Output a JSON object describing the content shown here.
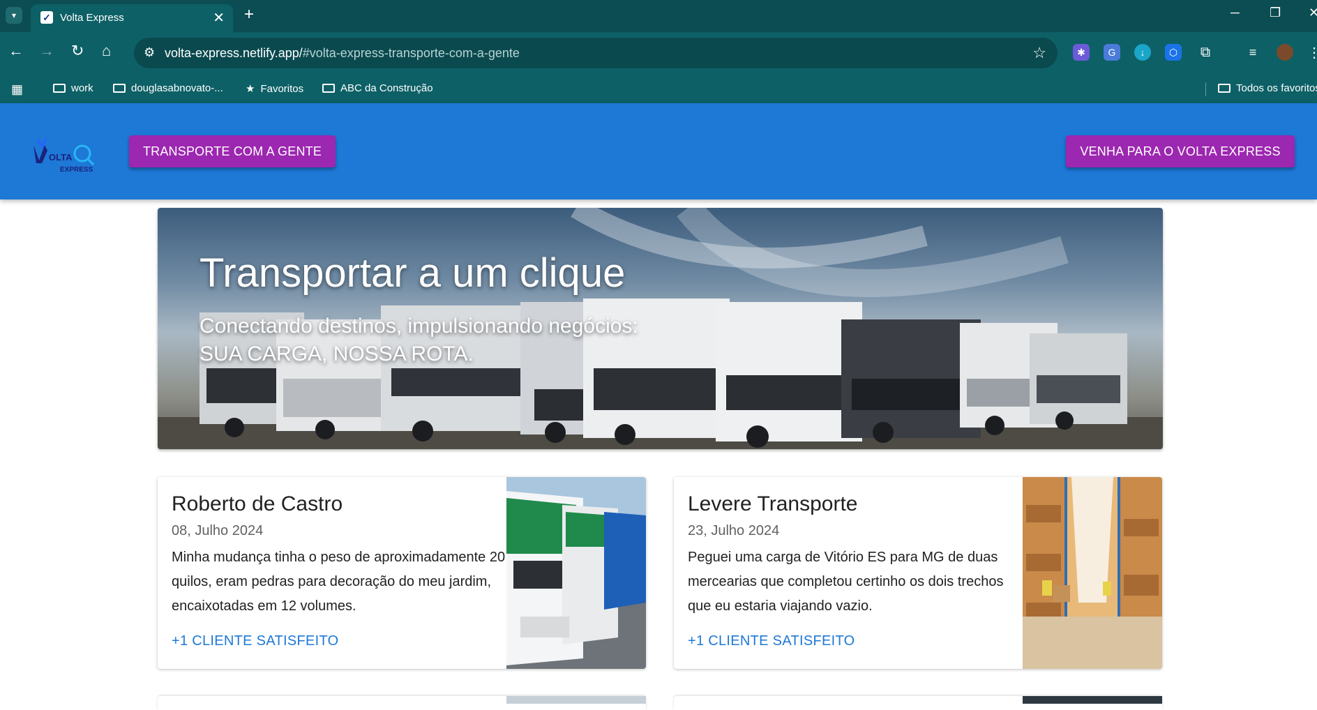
{
  "browser": {
    "tab_title": "Volta Express",
    "url_host": "volta-express.netlify.app/",
    "url_hash": "#volta-express-transporte-com-a-gente",
    "bookmarks": [
      "work",
      "douglasabnovato-...",
      "Favoritos",
      "ABC da Construção"
    ],
    "all_bookmarks": "Todos os favoritos"
  },
  "header": {
    "logo_text_top": "OLTA",
    "logo_text_bottom": "EXPRESS",
    "nav_button": "TRANSPORTE COM A GENTE",
    "cta_button": "VENHA PARA O VOLTA EXPRESS",
    "colors": {
      "bar": "#1e78d6",
      "button": "#9c27b0"
    }
  },
  "hero": {
    "title": "Transportar a um clique",
    "subtitle_line1": "Conectando destinos, impulsionando negócios:",
    "subtitle_line2": "SUA CARGA, NOSSA ROTA."
  },
  "testimonials": [
    {
      "name": "Roberto de Castro",
      "date": "08, Julho 2024",
      "text": "Minha mudança tinha o peso de aproximadamente 20 quilos, eram pedras para decoração do meu jardim, encaixotadas em 12 volumes.",
      "link": "+1 CLIENTE SATISFEITO",
      "image": "trucks-photo"
    },
    {
      "name": "Levere Transporte",
      "date": "23, Julho 2024",
      "text": "Peguei uma carga de Vitório ES para MG de duas mercearias que completou certinho os dois trechos que eu estaria viajando vazio.",
      "link": "+1 CLIENTE SATISFEITO",
      "image": "warehouse-photo"
    }
  ]
}
